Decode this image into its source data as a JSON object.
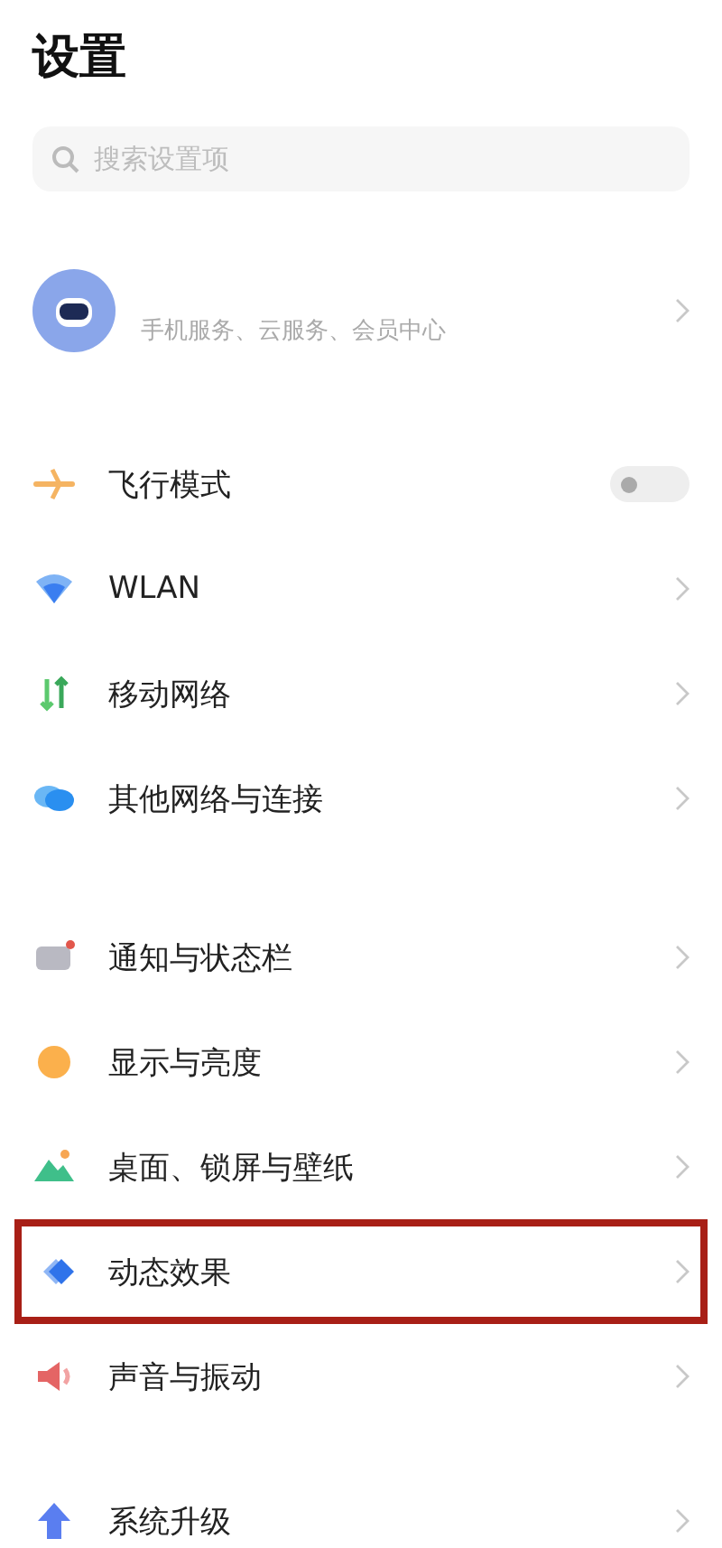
{
  "title": "设置",
  "search": {
    "placeholder": "搜索设置项"
  },
  "account": {
    "subtitle": "手机服务、云服务、会员中心"
  },
  "groups": [
    {
      "items": [
        {
          "kind": "toggle",
          "label": "飞行模式",
          "on": false,
          "highlighted": false
        },
        {
          "kind": "link",
          "label": "WLAN",
          "highlighted": false
        },
        {
          "kind": "link",
          "label": "移动网络",
          "highlighted": false
        },
        {
          "kind": "link",
          "label": "其他网络与连接",
          "highlighted": false
        }
      ]
    },
    {
      "items": [
        {
          "kind": "link",
          "label": "通知与状态栏",
          "highlighted": false
        },
        {
          "kind": "link",
          "label": "显示与亮度",
          "highlighted": false
        },
        {
          "kind": "link",
          "label": "桌面、锁屏与壁纸",
          "highlighted": false
        },
        {
          "kind": "link",
          "label": "动态效果",
          "highlighted": true
        },
        {
          "kind": "link",
          "label": "声音与振动",
          "highlighted": false
        }
      ]
    },
    {
      "items": [
        {
          "kind": "link",
          "label": "系统升级",
          "highlighted": false
        }
      ]
    }
  ]
}
